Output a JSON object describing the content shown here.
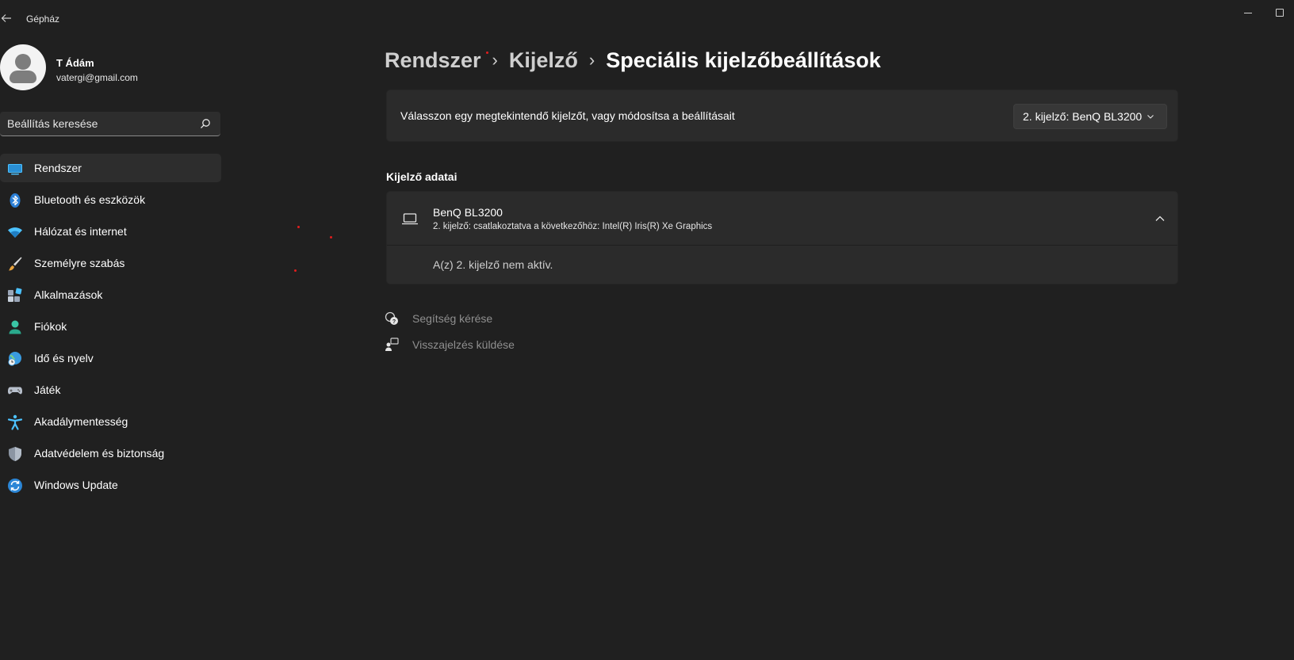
{
  "window": {
    "title": "Gépház"
  },
  "profile": {
    "name": "T Ádám",
    "email": "vatergi@gmail.com"
  },
  "search": {
    "placeholder": "Beállítás keresése"
  },
  "nav": {
    "items": [
      {
        "label": "Rendszer",
        "icon": "system-icon",
        "active": true
      },
      {
        "label": "Bluetooth és eszközök",
        "icon": "bluetooth-icon"
      },
      {
        "label": "Hálózat és internet",
        "icon": "wifi-icon"
      },
      {
        "label": "Személyre szabás",
        "icon": "paintbrush-icon"
      },
      {
        "label": "Alkalmazások",
        "icon": "apps-icon"
      },
      {
        "label": "Fiókok",
        "icon": "account-icon"
      },
      {
        "label": "Idő és nyelv",
        "icon": "globe-clock-icon"
      },
      {
        "label": "Játék",
        "icon": "gamepad-icon"
      },
      {
        "label": "Akadálymentesség",
        "icon": "accessibility-icon"
      },
      {
        "label": "Adatvédelem és biztonság",
        "icon": "shield-icon"
      },
      {
        "label": "Windows Update",
        "icon": "update-icon"
      }
    ]
  },
  "breadcrumb": {
    "items": [
      "Rendszer",
      "Kijelző"
    ],
    "current": "Speciális kijelzőbeállítások"
  },
  "display_select": {
    "label": "Válasszon egy megtekintendő kijelzőt, vagy módosítsa a beállításait",
    "selected": "2. kijelző: BenQ BL3200"
  },
  "display_info": {
    "section_title": "Kijelző adatai",
    "name": "BenQ BL3200",
    "description": "2. kijelző: csatlakoztatva a következőhöz: Intel(R) Iris(R) Xe Graphics",
    "status": "A(z) 2. kijelző nem aktív."
  },
  "links": {
    "help": "Segítség kérése",
    "feedback": "Visszajelzés küldése"
  },
  "colors": {
    "background": "#202020",
    "card": "#2b2b2b",
    "accent": "#4cc2ff"
  }
}
